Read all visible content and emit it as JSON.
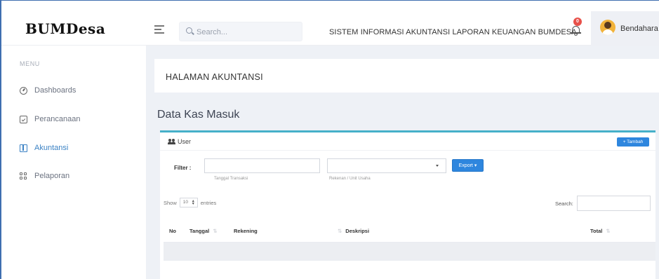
{
  "app": {
    "logo": "BUMDesa",
    "search_placeholder": "Search...",
    "system_title": "SISTEM INFORMASI AKUNTANSI LAPORAN KEUANGAN BUMDESA",
    "notification_count": "0",
    "user_name": "Bendahara"
  },
  "sidebar": {
    "menu_title": "MENU",
    "items": [
      {
        "label": "Dashboards",
        "icon": "dashboard-icon",
        "active": false
      },
      {
        "label": "Perancanaan",
        "icon": "plan-icon",
        "active": false
      },
      {
        "label": "Akuntansi",
        "icon": "accounting-icon",
        "active": true
      },
      {
        "label": "Pelaporan",
        "icon": "report-grid-icon",
        "active": false
      }
    ]
  },
  "main": {
    "page_heading": "HALAMAN AKUNTANSI",
    "page_subtitle": "Data Kas Masuk",
    "card": {
      "title": "User",
      "add_button": "+ Tambah",
      "filter_label": "Filter :",
      "date_hint": "Tanggal Transaksi",
      "select_hint": "Rekenan / Unit Usaha",
      "export_button": "Export ▾",
      "show_prefix": "Show",
      "show_value": "10",
      "show_suffix": "entries",
      "search_label": "Search:",
      "columns": [
        "No",
        "Tanggal",
        "Rekening",
        "Deskripsi",
        "Total"
      ]
    }
  },
  "colors": {
    "accent": "#2e86de",
    "card_top": "#45b0c9",
    "active_nav": "#3b82c4",
    "badge": "#e8514a"
  }
}
